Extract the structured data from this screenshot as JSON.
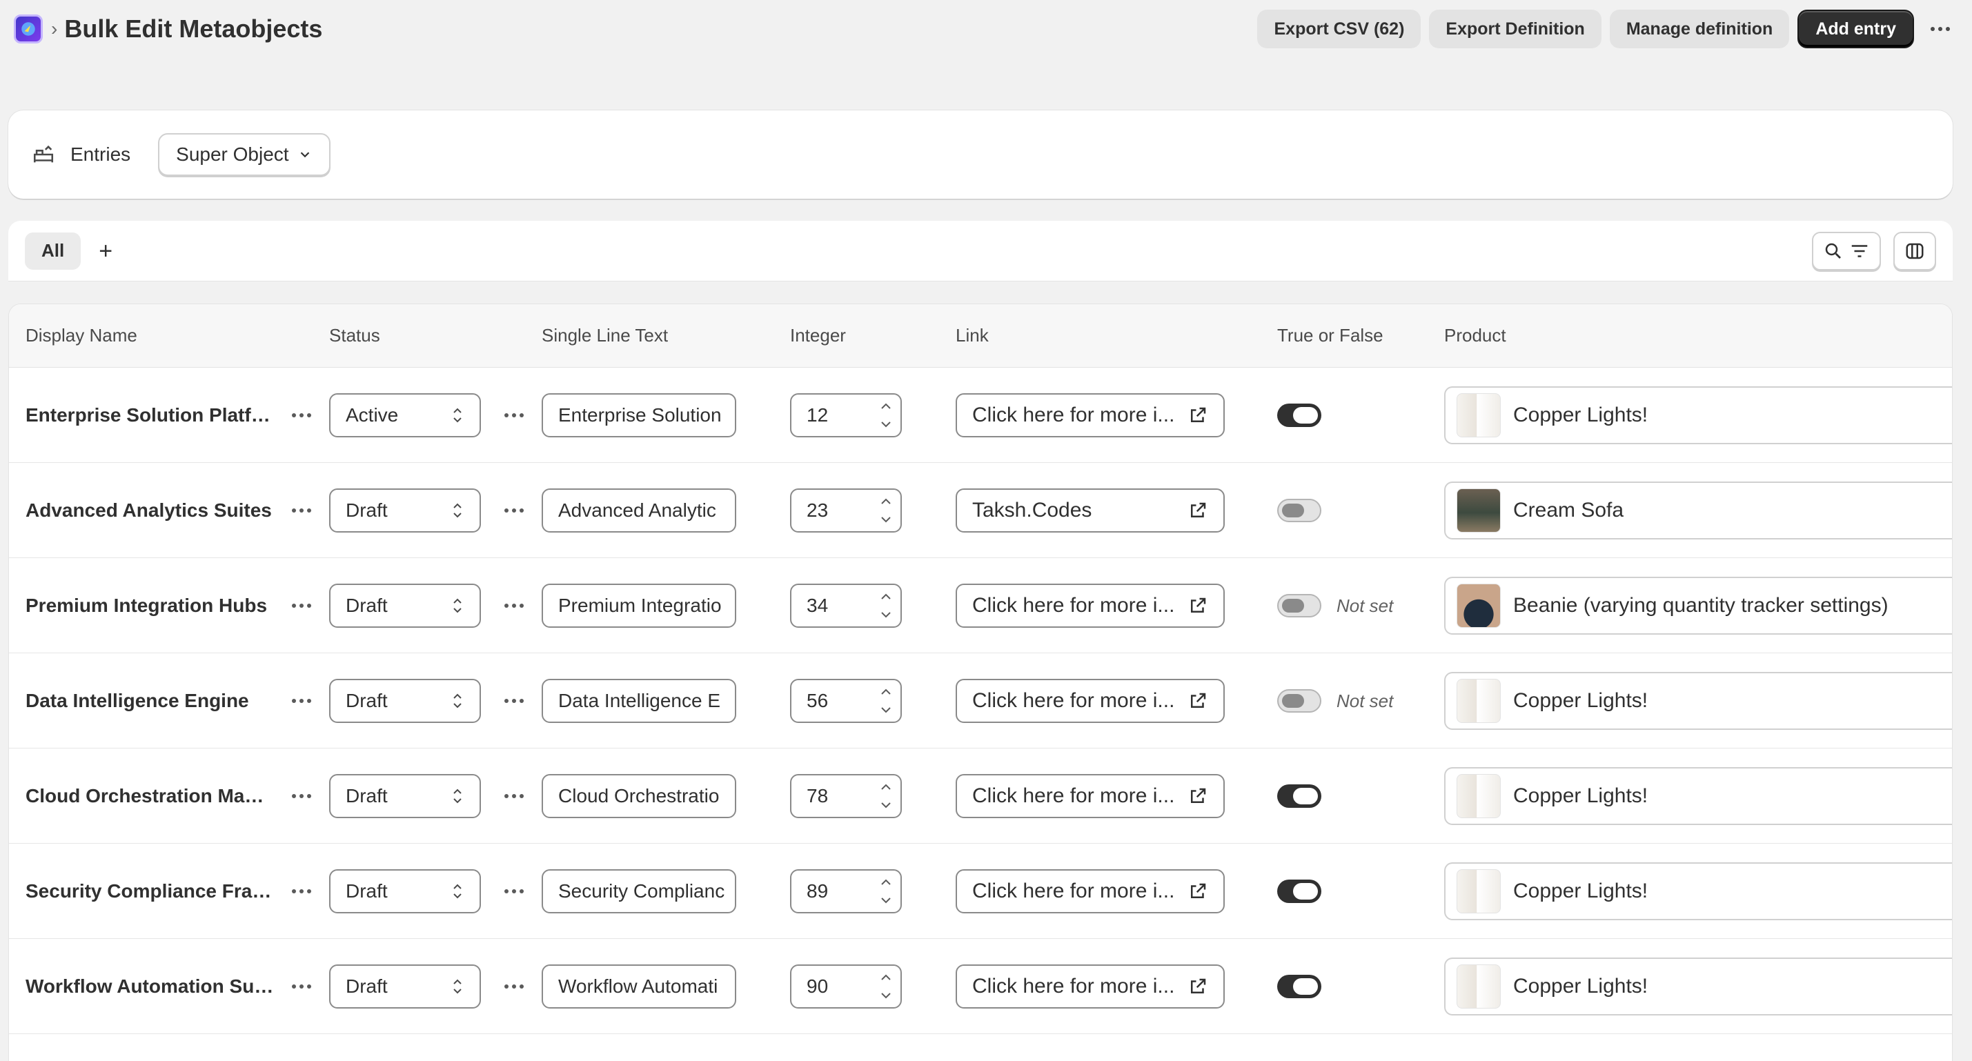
{
  "header": {
    "title": "Bulk Edit Metaobjects",
    "actions": {
      "export_csv": "Export CSV (62)",
      "export_definition": "Export Definition",
      "manage_definition": "Manage definition",
      "add_entry": "Add entry"
    }
  },
  "entries": {
    "label": "Entries",
    "selected_type": "Super Object"
  },
  "tabs": {
    "all": "All",
    "add": "+"
  },
  "table": {
    "columns": [
      "Display Name",
      "Status",
      "Single Line Text",
      "Integer",
      "Link",
      "True or False",
      "Product"
    ],
    "rows": [
      {
        "name": "Enterprise Solution Platfor...",
        "status": "Active",
        "text": "Enterprise Solution",
        "integer": "12",
        "link": "Click here for more i...",
        "bool": true,
        "bool_text": "",
        "product": "Copper Lights!",
        "thumb": "copper"
      },
      {
        "name": "Advanced Analytics Suites",
        "status": "Draft",
        "text": "Advanced Analytic",
        "integer": "23",
        "link": "Taksh.Codes",
        "bool": false,
        "bool_text": "",
        "product": "Cream Sofa",
        "thumb": "sofa"
      },
      {
        "name": "Premium Integration Hubs",
        "status": "Draft",
        "text": "Premium Integratio",
        "integer": "34",
        "link": "Click here for more i...",
        "bool": false,
        "bool_text": "Not set",
        "product": "Beanie (varying quantity tracker settings)",
        "thumb": "beanie"
      },
      {
        "name": "Data Intelligence Engine",
        "status": "Draft",
        "text": "Data Intelligence E",
        "integer": "56",
        "link": "Click here for more i...",
        "bool": false,
        "bool_text": "Not set",
        "product": "Copper Lights!",
        "thumb": "copper"
      },
      {
        "name": "Cloud Orchestration Mana...",
        "status": "Draft",
        "text": "Cloud Orchestratio",
        "integer": "78",
        "link": "Click here for more i...",
        "bool": true,
        "bool_text": "",
        "product": "Copper Lights!",
        "thumb": "copper"
      },
      {
        "name": "Security Compliance Fram...",
        "status": "Draft",
        "text": "Security Complianc",
        "integer": "89",
        "link": "Click here for more i...",
        "bool": true,
        "bool_text": "",
        "product": "Copper Lights!",
        "thumb": "copper"
      },
      {
        "name": "Workflow Automation Suite",
        "status": "Draft",
        "text": "Workflow Automati",
        "integer": "90",
        "link": "Click here for more i...",
        "bool": true,
        "bool_text": "",
        "product": "Copper Lights!",
        "thumb": "copper"
      }
    ]
  },
  "icons": {
    "app": "app-logo-icon",
    "breadcrumb": "chevron-right-icon",
    "more": "more-horizontal-icon",
    "entries": "sofa-icon",
    "select": "chevron-down-icon",
    "search": "search-icon",
    "filter": "filter-icon",
    "columns": "columns-icon",
    "stepper": "selector-icon",
    "external": "external-link-icon"
  },
  "colors": {
    "primary": "#303030",
    "background": "#f1f1f1",
    "surface": "#ffffff"
  }
}
